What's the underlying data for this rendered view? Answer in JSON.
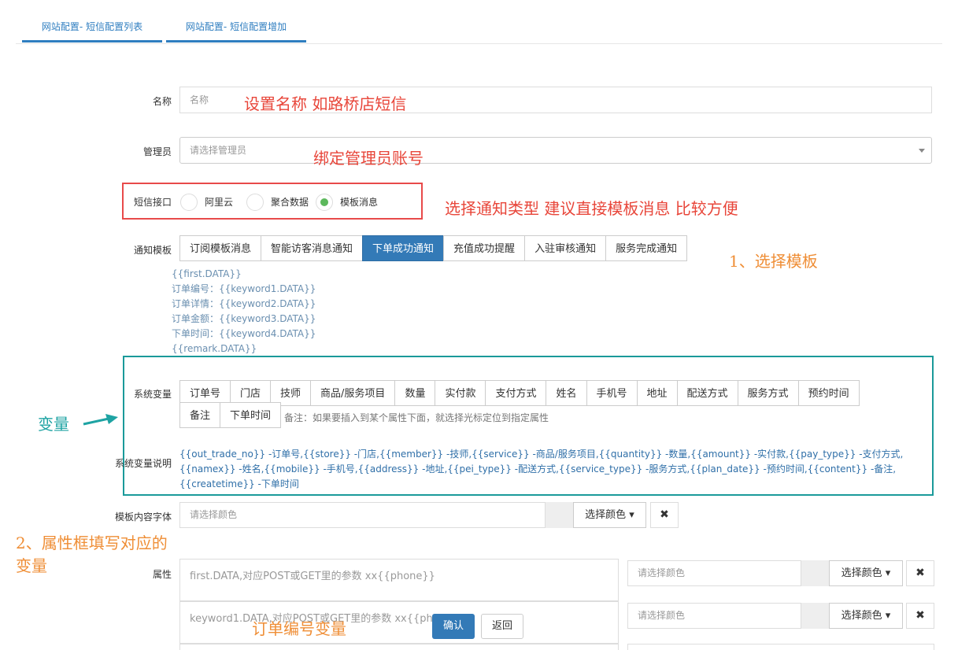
{
  "tabs": [
    {
      "label": "网站配置- 短信配置列表"
    },
    {
      "label": "网站配置- 短信配置增加"
    }
  ],
  "form": {
    "name_label": "名称",
    "name_placeholder": "名称",
    "admin_label": "管理员",
    "admin_placeholder": "请选择管理员",
    "sms_label": "短信接口",
    "sms_options": [
      "阿里云",
      "聚合数据",
      "模板消息"
    ],
    "sms_selected": "模板消息",
    "notify_label": "通知模板",
    "notify_templates": [
      "订阅模板消息",
      "智能访客消息通知",
      "下单成功通知",
      "充值成功提醒",
      "入驻审核通知",
      "服务完成通知"
    ],
    "notify_selected": "下单成功通知",
    "template_lines": [
      "{{first.DATA}}",
      "订单编号：{{keyword1.DATA}}",
      "订单详情：{{keyword2.DATA}}",
      "订单金额：{{keyword3.DATA}}",
      "下单时间：{{keyword4.DATA}}",
      "{{remark.DATA}}"
    ],
    "sysvar_label": "系统变量",
    "sysvars_row1": [
      "订单号",
      "门店",
      "技师",
      "商品/服务项目",
      "数量",
      "实付款",
      "支付方式",
      "姓名",
      "手机号",
      "地址",
      "配送方式",
      "服务方式",
      "预约时间"
    ],
    "sysvars_row2": [
      "备注",
      "下单时间"
    ],
    "sysvar_hint": "备注：如果要插入到某个属性下面，就选择光标定位到指定属性",
    "sysvar_desc_label": "系统变量说明",
    "sysvar_desc": "{{out_trade_no}} -订单号,{{store}} -门店,{{member}} -技师,{{service}} -商品/服务项目,{{quantity}} -数量,{{amount}} -实付款,{{pay_type}} -支付方式,{{namex}} -姓名,{{mobile}} -手机号,{{address}} -地址,{{pei_type}} -配送方式,{{service_type}} -服务方式,{{plan_date}} -预约时间,{{content}} -备注,{{createtime}} -下单时间",
    "font_label": "模板内容字体",
    "color_placeholder": "请选择颜色",
    "color_btn": "选择颜色",
    "close_icon": "✖",
    "attr_label": "属性",
    "attr1_value": "first.DATA,对应POST或GET里的参数  xx{{phone}}",
    "attr2_value": "keyword1.DATA,对应POST或GET里的参数  xx{{phone}}",
    "confirm_btn": "确认",
    "back_btn": "返回"
  },
  "annotations": {
    "name": "设置名称  如路桥店短信",
    "admin": "绑定管理员账号",
    "sms": "选择通知类型  建议直接模板消息  比较方便",
    "step1": "1、选择模板",
    "variable": "变量",
    "step2_line1": "2、属性框填写对应的",
    "step2_line2": "变量",
    "order_var": "订单编号变量"
  },
  "colors": {
    "primary": "#337ab7",
    "annotation_red": "#e8463a",
    "annotation_orange": "#ef8e36",
    "annotation_teal": "#1ea3a3",
    "radio_selected": "#5cb85c"
  }
}
